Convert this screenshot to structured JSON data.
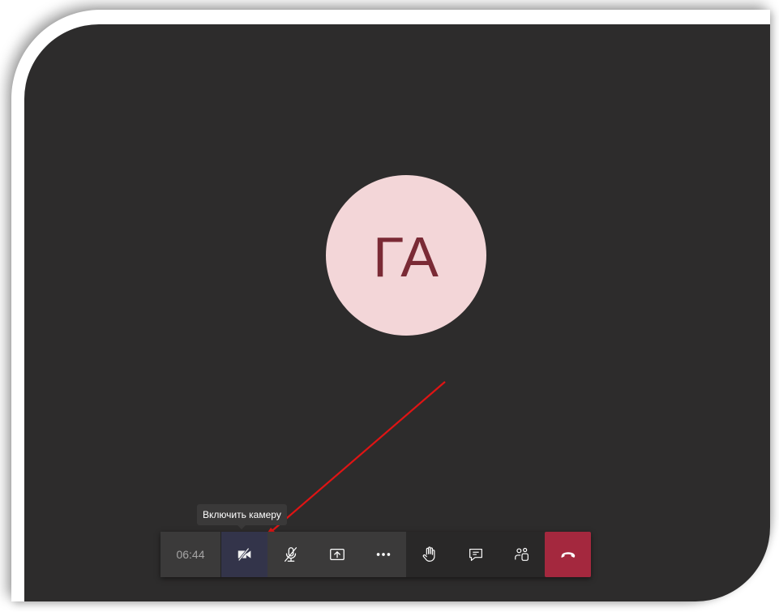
{
  "call": {
    "participant_initials": "ГА",
    "timer": "06:44",
    "tooltip": "Включить камеру"
  },
  "toolbar": {
    "buttons": [
      {
        "name": "camera-toggle",
        "icon": "video-off-icon",
        "label": "Включить камеру",
        "active": true
      },
      {
        "name": "mic-toggle",
        "icon": "mic-off-icon"
      },
      {
        "name": "share-screen",
        "icon": "share-screen-icon"
      },
      {
        "name": "more-actions",
        "icon": "more-dots-icon"
      },
      {
        "name": "raise-hand",
        "icon": "raise-hand-icon"
      },
      {
        "name": "chat",
        "icon": "chat-icon"
      },
      {
        "name": "participants",
        "icon": "participants-icon"
      },
      {
        "name": "hang-up",
        "icon": "hang-up-icon"
      }
    ]
  },
  "colors": {
    "background": "#2d2c2c",
    "avatar_bg": "#f3d6d8",
    "avatar_text": "#7a2a35",
    "hangup": "#a4283e",
    "annotation_arrow": "#e01414"
  }
}
